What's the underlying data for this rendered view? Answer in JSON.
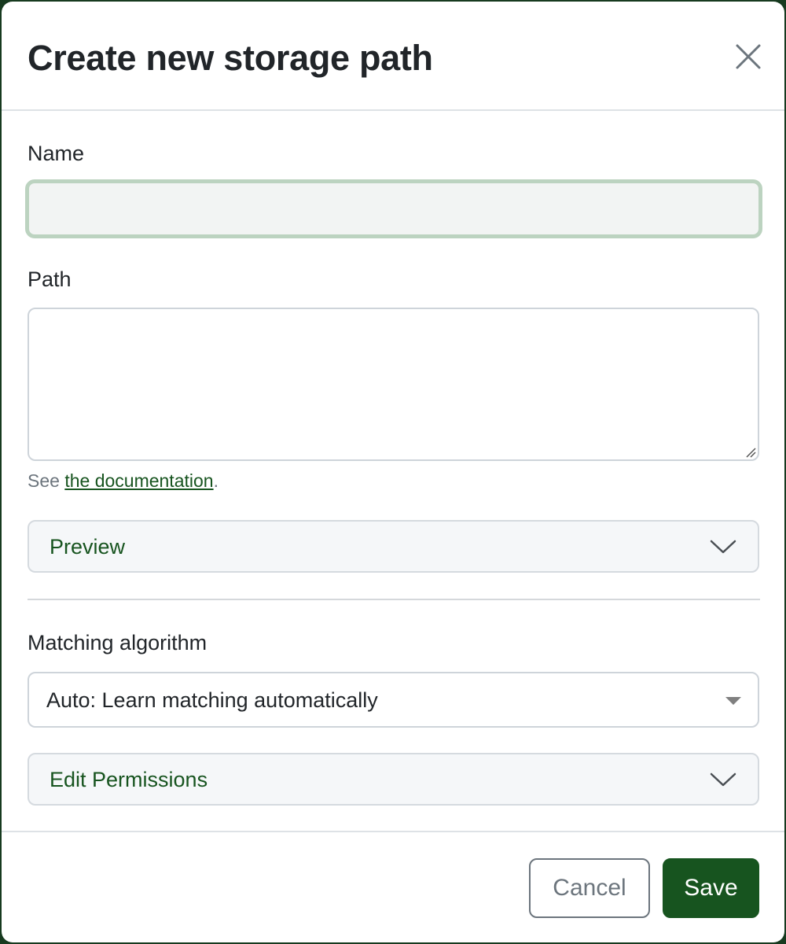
{
  "modal": {
    "title": "Create new storage path"
  },
  "form": {
    "name": {
      "label": "Name",
      "value": "",
      "placeholder": ""
    },
    "path": {
      "label": "Path",
      "value": "",
      "help_prefix": "See ",
      "help_link": "the documentation",
      "help_suffix": "."
    },
    "preview": {
      "label": "Preview"
    },
    "matching_algorithm": {
      "label": "Matching algorithm",
      "selected": "Auto: Learn matching automatically"
    },
    "permissions": {
      "label": "Edit Permissions"
    }
  },
  "footer": {
    "cancel_label": "Cancel",
    "save_label": "Save"
  },
  "colors": {
    "accent": "#17541f",
    "input_focus_border": "#bcd3c0",
    "muted": "#6c757d"
  },
  "icons": {
    "close": "close-icon",
    "preview_toggle": "chevron-down-icon",
    "select_caret": "caret-down-icon",
    "permissions_toggle": "chevron-down-icon"
  }
}
